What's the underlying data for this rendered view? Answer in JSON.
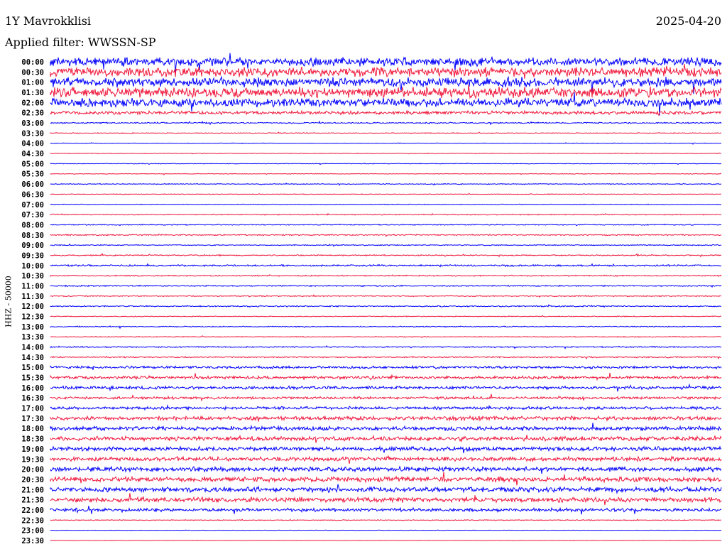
{
  "header": {
    "station": "1Y Mavrokklisi",
    "filter": "Applied filter: WWSSN-SP",
    "date": "2025-04-20"
  },
  "chart_data": {
    "type": "line",
    "title": "1Y Mavrokklisi",
    "ylabel": "HHZ - 50000",
    "xlabel": "",
    "series_colors": [
      "#0000ff",
      "#f0183c"
    ],
    "tick_labels": [
      "00:00",
      "00:30",
      "01:00",
      "01:30",
      "02:00",
      "02:30",
      "03:00",
      "03:30",
      "04:00",
      "04:30",
      "05:00",
      "05:30",
      "06:00",
      "06:30",
      "07:00",
      "07:30",
      "08:00",
      "08:30",
      "09:00",
      "09:30",
      "10:00",
      "10:30",
      "11:00",
      "11:30",
      "12:00",
      "12:30",
      "13:00",
      "13:30",
      "14:00",
      "14:30",
      "15:00",
      "15:30",
      "16:00",
      "16:30",
      "17:00",
      "17:30",
      "18:00",
      "18:30",
      "19:00",
      "19:30",
      "20:00",
      "20:30",
      "21:00",
      "21:30",
      "22:00",
      "22:30",
      "23:00",
      "23:30"
    ],
    "relative_noise_level": [
      10,
      11,
      11,
      12,
      10,
      4,
      1.5,
      1,
      0.8,
      0.8,
      0.8,
      0.8,
      1,
      0.8,
      0.8,
      1.2,
      1.2,
      1.5,
      1.2,
      1.5,
      2,
      1.5,
      1.5,
      1.2,
      1.5,
      1,
      1.2,
      1,
      1.5,
      1.5,
      3,
      3.5,
      3.5,
      3,
      3.5,
      4.5,
      5,
      5,
      5,
      5,
      5.5,
      6,
      6,
      6,
      4,
      1,
      0.6,
      0.5
    ]
  }
}
